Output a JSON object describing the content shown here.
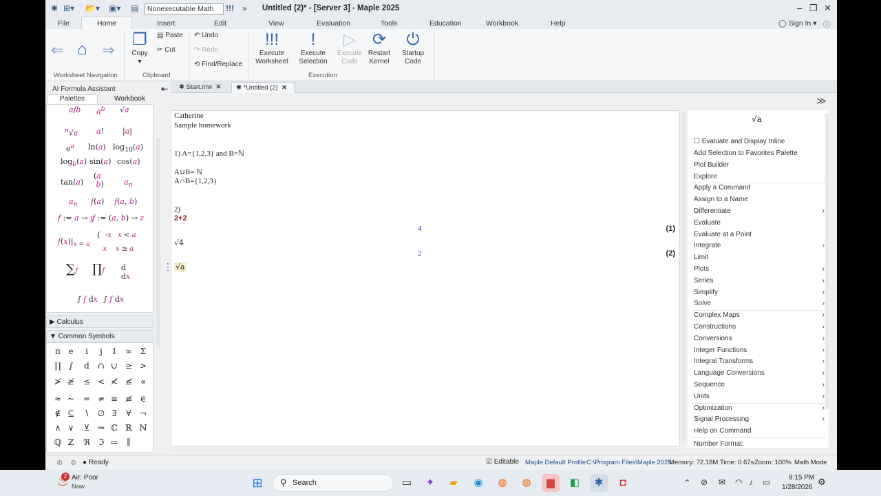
{
  "window": {
    "title": "Untitled (2)* - [Server 3] - Maple 2025",
    "mode": "Nonexecutable Math"
  },
  "menu": [
    "File",
    "Home",
    "Insert",
    "Edit",
    "View",
    "Evaluation",
    "Tools",
    "Education",
    "Workbook",
    "Help"
  ],
  "signin": "Sign In",
  "ribbon": {
    "copy": "Copy",
    "paste": "Paste",
    "cut": "Cut",
    "undo": "Undo",
    "redo": "Redo",
    "find": "Find/Replace",
    "execute_worksheet": "Execute\nWorksheet",
    "execute_selection": "Execute\nSelection",
    "execute_code": "Execute\nCode",
    "restart_kernel": "Restart\nKernel",
    "startup_code": "Startup\nCode",
    "groups": {
      "nav": "Worksheet Navigation",
      "clipboard": "Clipboard",
      "execution": "Execution"
    }
  },
  "doc_tabs": [
    "Start.mw",
    "*Untitled (2)"
  ],
  "left": {
    "ai": "AI Formula Assistant",
    "tabs": [
      "Palettes",
      "Workbook"
    ],
    "calculus": "Calculus",
    "common": "Common Symbols",
    "symbols": [
      "π",
      "e",
      "i",
      "j",
      "I",
      "∞",
      "Σ",
      "∏",
      "∫",
      "d",
      "∩",
      "∪",
      "≥",
      ">",
      "≯",
      "≱",
      "≤",
      "<",
      "≮",
      "≰",
      "∝",
      "≈",
      "~",
      "=",
      "≠",
      "≡",
      "≢",
      "∈",
      "∉",
      "⊆",
      "∖",
      "∅",
      "∃",
      "∀",
      "¬",
      "∧",
      "∨",
      "⊻",
      "⇒",
      "ℂ",
      "ℝ",
      "ℕ",
      "ℚ",
      "ℤ",
      "ℜ",
      "ℑ",
      "≔",
      "∥"
    ]
  },
  "worksheet": {
    "lines": [
      "Catherine",
      "Sample homework",
      "1) A={1,2,3}  and B=ℕ",
      "A∪B= ℕ",
      "A∩B={1,2,3}",
      "2)",
      "2+2",
      "√4",
      "√a"
    ],
    "outputs": [
      {
        "value": "4",
        "label": "(1)"
      },
      {
        "value": "2",
        "label": "(2)"
      }
    ]
  },
  "context": {
    "preview": "√a",
    "evaluate_inline": "Evaluate and Display Inline",
    "items": [
      {
        "t": "Add Selection to Favorites Palette",
        "a": false
      },
      {
        "t": "Plot Builder",
        "a": false
      },
      {
        "t": "Explore",
        "a": false
      },
      {
        "t": "Apply a Command",
        "a": false,
        "sep": true
      },
      {
        "t": "Assign to a Name",
        "a": false
      },
      {
        "t": "Differentiate",
        "a": true
      },
      {
        "t": "Evaluate",
        "a": false
      },
      {
        "t": "Evaluate at a Point",
        "a": false
      },
      {
        "t": "Integrate",
        "a": true
      },
      {
        "t": "Limit",
        "a": false
      },
      {
        "t": "Plots",
        "a": true
      },
      {
        "t": "Series",
        "a": true
      },
      {
        "t": "Simplify",
        "a": true
      },
      {
        "t": "Solve",
        "a": true
      },
      {
        "t": "Complex Maps",
        "a": true,
        "sep": true
      },
      {
        "t": "Constructions",
        "a": true
      },
      {
        "t": "Conversions",
        "a": true
      },
      {
        "t": "Integer Functions",
        "a": true
      },
      {
        "t": "Integral Transforms",
        "a": true
      },
      {
        "t": "Language Conversions",
        "a": true
      },
      {
        "t": "Sequence",
        "a": true
      },
      {
        "t": "Units",
        "a": true
      },
      {
        "t": "Optimization",
        "a": true,
        "sep": true
      },
      {
        "t": "Signal Processing",
        "a": true
      },
      {
        "t": "Help on Command",
        "a": false
      },
      {
        "t": "Number Format:",
        "a": false,
        "sep": true
      }
    ]
  },
  "status": {
    "ready": "Ready",
    "editable": "Editable",
    "profile": "Maple Default Profile",
    "path": "C:\\Program Files\\Maple 2025",
    "memory": "Memory: 72.18M",
    "time": "Time: 0.67s",
    "zoom": "Zoom: 100%",
    "mode": "Math Mode"
  },
  "taskbar": {
    "weather": "Air: Poor",
    "weather_sub": "Now",
    "search": "Search",
    "time": "9:15 PM",
    "date": "1/28/2026",
    "badge": "2"
  }
}
